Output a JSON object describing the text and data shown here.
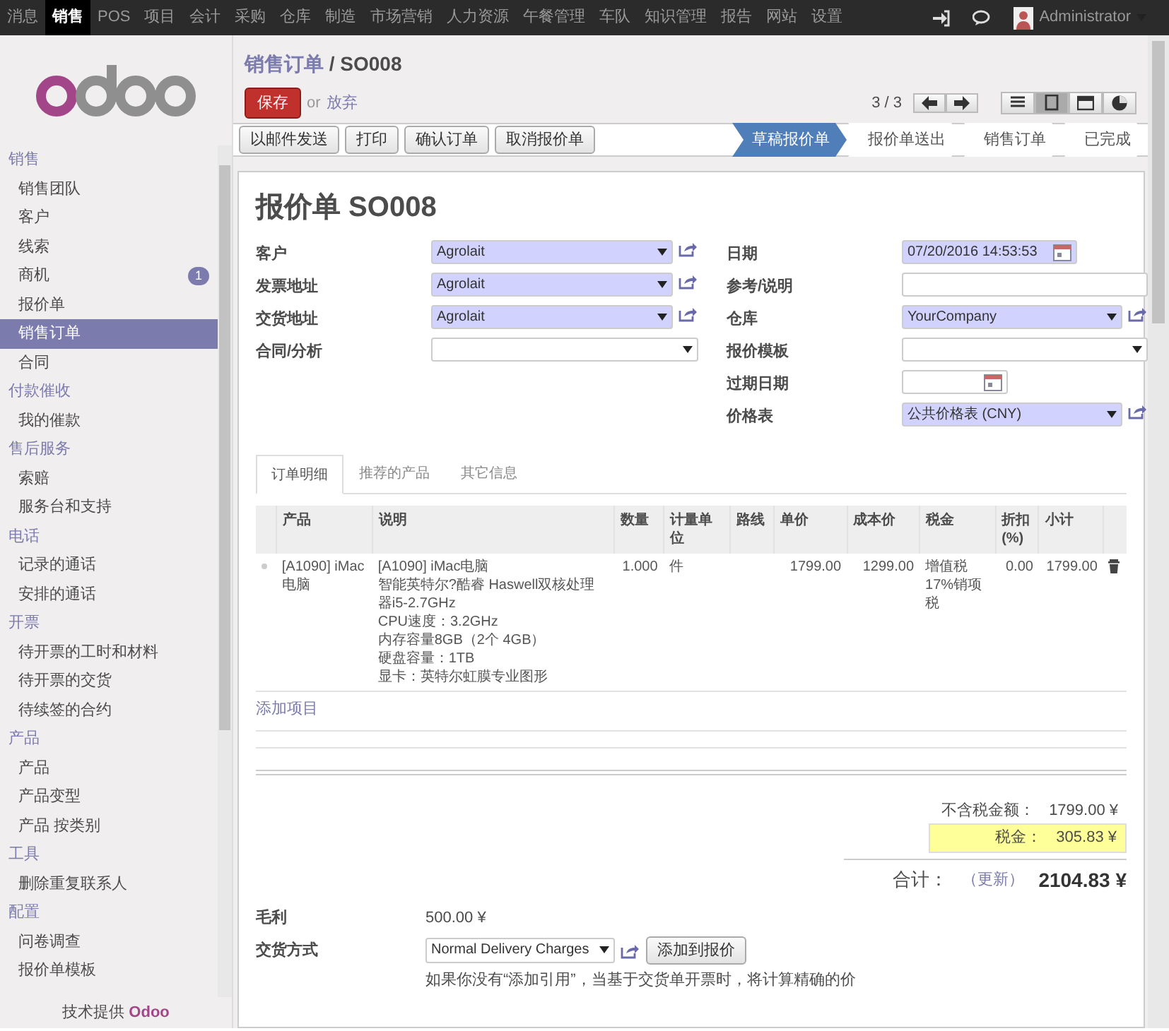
{
  "top_menu": [
    {
      "label": "消息",
      "selected": false
    },
    {
      "label": "销售",
      "selected": true
    },
    {
      "label": "POS",
      "selected": false
    },
    {
      "label": "项目",
      "selected": false
    },
    {
      "label": "会计",
      "selected": false
    },
    {
      "label": "采购",
      "selected": false
    },
    {
      "label": "仓库",
      "selected": false
    },
    {
      "label": "制造",
      "selected": false
    },
    {
      "label": "市场营销",
      "selected": false
    },
    {
      "label": "人力资源",
      "selected": false
    },
    {
      "label": "午餐管理",
      "selected": false
    },
    {
      "label": "车队",
      "selected": false
    },
    {
      "label": "知识管理",
      "selected": false
    },
    {
      "label": "报告",
      "selected": false
    },
    {
      "label": "网站",
      "selected": false
    },
    {
      "label": "设置",
      "selected": false
    }
  ],
  "user": {
    "name": "Administrator"
  },
  "sidebar": {
    "sections": [
      {
        "title": "销售",
        "items": [
          {
            "label": "销售团队",
            "selected": false
          },
          {
            "label": "客户",
            "selected": false
          },
          {
            "label": "线索",
            "selected": false
          },
          {
            "label": "商机",
            "selected": false,
            "badge": "1"
          },
          {
            "label": "报价单",
            "selected": false
          },
          {
            "label": "销售订单",
            "selected": true
          },
          {
            "label": "合同",
            "selected": false
          }
        ]
      },
      {
        "title": "付款催收",
        "items": [
          {
            "label": "我的催款",
            "selected": false
          }
        ]
      },
      {
        "title": "售后服务",
        "items": [
          {
            "label": "索赔",
            "selected": false
          },
          {
            "label": "服务台和支持",
            "selected": false
          }
        ]
      },
      {
        "title": "电话",
        "items": [
          {
            "label": "记录的通话",
            "selected": false
          },
          {
            "label": "安排的通话",
            "selected": false
          }
        ]
      },
      {
        "title": "开票",
        "items": [
          {
            "label": "待开票的工时和材料",
            "selected": false
          },
          {
            "label": "待开票的交货",
            "selected": false
          },
          {
            "label": "待续签的合约",
            "selected": false
          }
        ]
      },
      {
        "title": "产品",
        "items": [
          {
            "label": "产品",
            "selected": false
          },
          {
            "label": "产品变型",
            "selected": false
          },
          {
            "label": "产品 按类别",
            "selected": false
          }
        ]
      },
      {
        "title": "工具",
        "items": [
          {
            "label": "删除重复联系人",
            "selected": false
          }
        ]
      },
      {
        "title": "配置",
        "items": [
          {
            "label": "问卷调查",
            "selected": false
          },
          {
            "label": "报价单模板",
            "selected": false
          }
        ]
      }
    ],
    "footer": {
      "prefix": "技术提供",
      "brand": "Odoo"
    }
  },
  "breadcrumb": {
    "parent": "销售订单",
    "separator": "/",
    "current": "SO008"
  },
  "save_button": "保存",
  "or_text": "or",
  "discard_link": "放弃",
  "pager": "3 / 3",
  "views": [
    {
      "kind": "list",
      "selected": false
    },
    {
      "kind": "form",
      "selected": true
    },
    {
      "kind": "calendar",
      "selected": false
    },
    {
      "kind": "graph",
      "selected": false
    }
  ],
  "actions": [
    "以邮件发送",
    "打印",
    "确认订单",
    "取消报价单"
  ],
  "stages": [
    {
      "label": "草稿报价单",
      "selected": true
    },
    {
      "label": "报价单送出",
      "selected": false
    },
    {
      "label": "销售订单",
      "selected": false
    },
    {
      "label": "已完成",
      "selected": false
    }
  ],
  "form_title": "报价单 SO008",
  "left_fields": [
    {
      "label": "客户",
      "kind": "select",
      "value": "Agrolait",
      "required": true,
      "link": true
    },
    {
      "label": "发票地址",
      "kind": "select",
      "value": "Agrolait",
      "required": true,
      "link": true
    },
    {
      "label": "交货地址",
      "kind": "select",
      "value": "Agrolait",
      "required": true,
      "link": true
    },
    {
      "label": "合同/分析",
      "kind": "select",
      "required": false,
      "link": false
    }
  ],
  "right_fields": [
    {
      "label": "日期",
      "kind": "date",
      "value": "07/20/2016 14:53:53",
      "required": true,
      "link": false
    },
    {
      "label": "参考/说明",
      "kind": "text",
      "required": false,
      "link": false
    },
    {
      "label": "仓库",
      "kind": "select",
      "value": "YourCompany",
      "required": true,
      "link": true
    },
    {
      "label": "报价模板",
      "kind": "select",
      "required": false,
      "link": false
    },
    {
      "label": "过期日期",
      "kind": "date",
      "required": false,
      "link": false
    },
    {
      "label": "价格表",
      "kind": "select",
      "value": "公共价格表 (CNY)",
      "required": true,
      "link": true
    }
  ],
  "tabs": [
    {
      "label": "订单明细",
      "selected": true
    },
    {
      "label": "推荐的产品",
      "selected": false
    },
    {
      "label": "其它信息",
      "selected": false
    }
  ],
  "table": {
    "columns": [
      "产品",
      "说明",
      "数量",
      "计量单位",
      "路线",
      "单价",
      "成本价",
      "税金",
      "折扣 (%)",
      "小计"
    ],
    "rows": [
      {
        "cells": [
          "[A1090] iMac电脑",
          [
            "[A1090] iMac电脑",
            "智能英特尔?酷睿 Haswell双核处理器i5-2.7GHz",
            "CPU速度：3.2GHz",
            "内存容量8GB（2个 4GB）",
            "硬盘容量：1TB",
            "显卡：英特尔虹膜专业图形"
          ],
          "1.000",
          "件",
          "",
          "1799.00",
          "1299.00",
          "增值税17%销项税",
          "0.00",
          "1799.00"
        ]
      }
    ],
    "add_item": "添加项目"
  },
  "totals": [
    {
      "label": "不含税金额：",
      "value": "1799.00 ¥",
      "highlighted": false
    },
    {
      "label": "税金：",
      "value": "305.83 ¥",
      "highlighted": true
    }
  ],
  "grand_total": {
    "label": "合计：",
    "update": "（更新）",
    "value": "2104.83 ¥"
  },
  "margin": {
    "label": "毛利",
    "value": "500.00 ¥"
  },
  "delivery": {
    "label": "交货方式",
    "value": "Normal Delivery Charges",
    "button": "添加到报价",
    "note": "如果你没有“添加引用”，当基于交货单开票时，将计算精确的价"
  }
}
